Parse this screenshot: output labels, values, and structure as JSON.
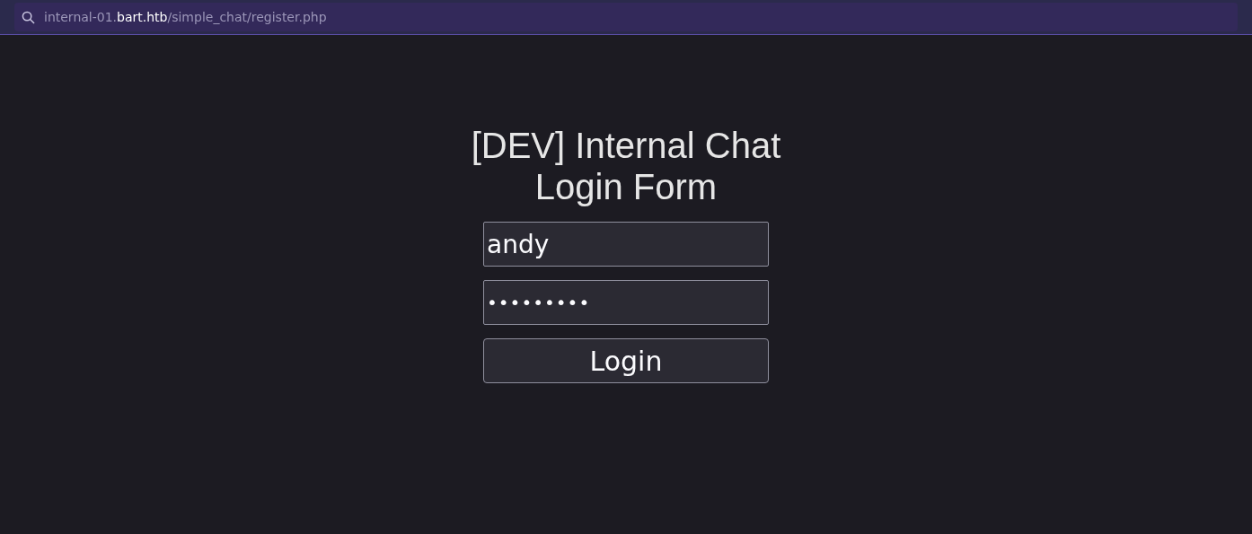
{
  "address_bar": {
    "url_prefix": "internal-01.",
    "url_domain": "bart.htb",
    "url_path": "/simple_chat/register.php"
  },
  "form": {
    "title_lines": [
      "[DEV] Internal Chat",
      "Login Form"
    ],
    "fields": [
      {
        "kind": "text",
        "value": "andy"
      },
      {
        "kind": "password",
        "value": "•••••••••"
      }
    ],
    "button": "Login"
  }
}
